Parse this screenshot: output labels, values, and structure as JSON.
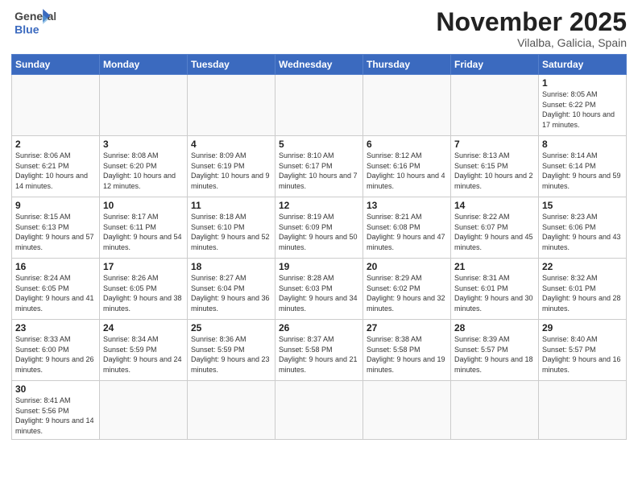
{
  "header": {
    "logo_line1": "General",
    "logo_line2": "Blue",
    "title": "November 2025",
    "subtitle": "Vilalba, Galicia, Spain"
  },
  "days_of_week": [
    "Sunday",
    "Monday",
    "Tuesday",
    "Wednesday",
    "Thursday",
    "Friday",
    "Saturday"
  ],
  "weeks": [
    [
      {
        "day": "",
        "info": ""
      },
      {
        "day": "",
        "info": ""
      },
      {
        "day": "",
        "info": ""
      },
      {
        "day": "",
        "info": ""
      },
      {
        "day": "",
        "info": ""
      },
      {
        "day": "",
        "info": ""
      },
      {
        "day": "1",
        "info": "Sunrise: 8:05 AM\nSunset: 6:22 PM\nDaylight: 10 hours\nand 17 minutes."
      }
    ],
    [
      {
        "day": "2",
        "info": "Sunrise: 8:06 AM\nSunset: 6:21 PM\nDaylight: 10 hours\nand 14 minutes."
      },
      {
        "day": "3",
        "info": "Sunrise: 8:08 AM\nSunset: 6:20 PM\nDaylight: 10 hours\nand 12 minutes."
      },
      {
        "day": "4",
        "info": "Sunrise: 8:09 AM\nSunset: 6:19 PM\nDaylight: 10 hours\nand 9 minutes."
      },
      {
        "day": "5",
        "info": "Sunrise: 8:10 AM\nSunset: 6:17 PM\nDaylight: 10 hours\nand 7 minutes."
      },
      {
        "day": "6",
        "info": "Sunrise: 8:12 AM\nSunset: 6:16 PM\nDaylight: 10 hours\nand 4 minutes."
      },
      {
        "day": "7",
        "info": "Sunrise: 8:13 AM\nSunset: 6:15 PM\nDaylight: 10 hours\nand 2 minutes."
      },
      {
        "day": "8",
        "info": "Sunrise: 8:14 AM\nSunset: 6:14 PM\nDaylight: 9 hours\nand 59 minutes."
      }
    ],
    [
      {
        "day": "9",
        "info": "Sunrise: 8:15 AM\nSunset: 6:13 PM\nDaylight: 9 hours\nand 57 minutes."
      },
      {
        "day": "10",
        "info": "Sunrise: 8:17 AM\nSunset: 6:11 PM\nDaylight: 9 hours\nand 54 minutes."
      },
      {
        "day": "11",
        "info": "Sunrise: 8:18 AM\nSunset: 6:10 PM\nDaylight: 9 hours\nand 52 minutes."
      },
      {
        "day": "12",
        "info": "Sunrise: 8:19 AM\nSunset: 6:09 PM\nDaylight: 9 hours\nand 50 minutes."
      },
      {
        "day": "13",
        "info": "Sunrise: 8:21 AM\nSunset: 6:08 PM\nDaylight: 9 hours\nand 47 minutes."
      },
      {
        "day": "14",
        "info": "Sunrise: 8:22 AM\nSunset: 6:07 PM\nDaylight: 9 hours\nand 45 minutes."
      },
      {
        "day": "15",
        "info": "Sunrise: 8:23 AM\nSunset: 6:06 PM\nDaylight: 9 hours\nand 43 minutes."
      }
    ],
    [
      {
        "day": "16",
        "info": "Sunrise: 8:24 AM\nSunset: 6:05 PM\nDaylight: 9 hours\nand 41 minutes."
      },
      {
        "day": "17",
        "info": "Sunrise: 8:26 AM\nSunset: 6:05 PM\nDaylight: 9 hours\nand 38 minutes."
      },
      {
        "day": "18",
        "info": "Sunrise: 8:27 AM\nSunset: 6:04 PM\nDaylight: 9 hours\nand 36 minutes."
      },
      {
        "day": "19",
        "info": "Sunrise: 8:28 AM\nSunset: 6:03 PM\nDaylight: 9 hours\nand 34 minutes."
      },
      {
        "day": "20",
        "info": "Sunrise: 8:29 AM\nSunset: 6:02 PM\nDaylight: 9 hours\nand 32 minutes."
      },
      {
        "day": "21",
        "info": "Sunrise: 8:31 AM\nSunset: 6:01 PM\nDaylight: 9 hours\nand 30 minutes."
      },
      {
        "day": "22",
        "info": "Sunrise: 8:32 AM\nSunset: 6:01 PM\nDaylight: 9 hours\nand 28 minutes."
      }
    ],
    [
      {
        "day": "23",
        "info": "Sunrise: 8:33 AM\nSunset: 6:00 PM\nDaylight: 9 hours\nand 26 minutes."
      },
      {
        "day": "24",
        "info": "Sunrise: 8:34 AM\nSunset: 5:59 PM\nDaylight: 9 hours\nand 24 minutes."
      },
      {
        "day": "25",
        "info": "Sunrise: 8:36 AM\nSunset: 5:59 PM\nDaylight: 9 hours\nand 23 minutes."
      },
      {
        "day": "26",
        "info": "Sunrise: 8:37 AM\nSunset: 5:58 PM\nDaylight: 9 hours\nand 21 minutes."
      },
      {
        "day": "27",
        "info": "Sunrise: 8:38 AM\nSunset: 5:58 PM\nDaylight: 9 hours\nand 19 minutes."
      },
      {
        "day": "28",
        "info": "Sunrise: 8:39 AM\nSunset: 5:57 PM\nDaylight: 9 hours\nand 18 minutes."
      },
      {
        "day": "29",
        "info": "Sunrise: 8:40 AM\nSunset: 5:57 PM\nDaylight: 9 hours\nand 16 minutes."
      }
    ],
    [
      {
        "day": "30",
        "info": "Sunrise: 8:41 AM\nSunset: 5:56 PM\nDaylight: 9 hours\nand 14 minutes."
      },
      {
        "day": "",
        "info": ""
      },
      {
        "day": "",
        "info": ""
      },
      {
        "day": "",
        "info": ""
      },
      {
        "day": "",
        "info": ""
      },
      {
        "day": "",
        "info": ""
      },
      {
        "day": "",
        "info": ""
      }
    ]
  ]
}
